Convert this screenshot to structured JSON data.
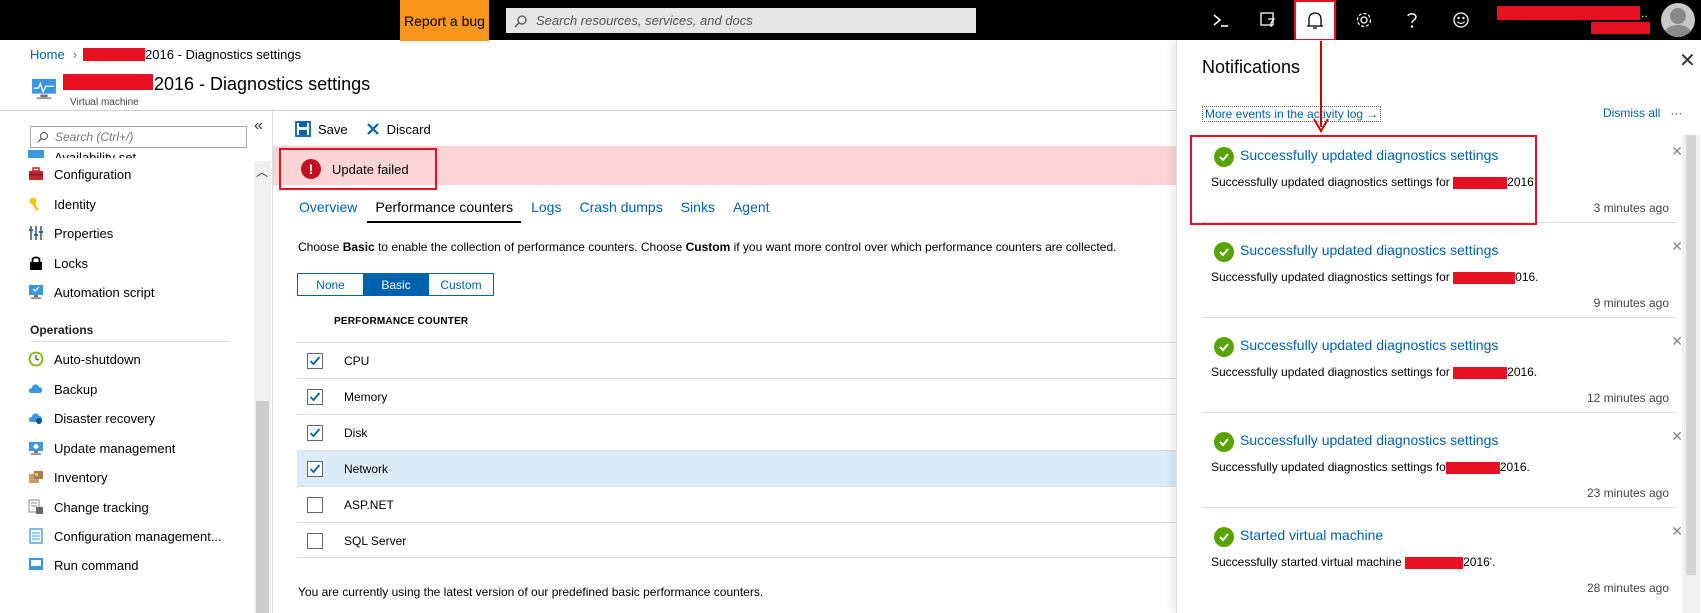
{
  "topbar": {
    "report_bug": "Report a bug",
    "search_placeholder": "Search resources, services, and docs",
    "more_dots": ".."
  },
  "breadcrumb": {
    "home": "Home",
    "current": "2016 - Diagnostics settings"
  },
  "header": {
    "title": "2016 - Diagnostics settings",
    "subtitle": "Virtual machine"
  },
  "sidebar": {
    "search_placeholder": "Search (Ctrl+/)",
    "collapse": "«",
    "partial_top": "Availability set",
    "items": [
      {
        "label": "Configuration",
        "icon": "toolbox-icon"
      },
      {
        "label": "Identity",
        "icon": "key-icon"
      },
      {
        "label": "Properties",
        "icon": "properties-icon"
      },
      {
        "label": "Locks",
        "icon": "lock-icon"
      },
      {
        "label": "Automation script",
        "icon": "script-icon"
      }
    ],
    "operations_heading": "Operations",
    "operations_items": [
      {
        "label": "Auto-shutdown",
        "icon": "clock-icon"
      },
      {
        "label": "Backup",
        "icon": "cloud-backup-icon"
      },
      {
        "label": "Disaster recovery",
        "icon": "cloud-recovery-icon"
      },
      {
        "label": "Update management",
        "icon": "monitor-icon"
      },
      {
        "label": "Inventory",
        "icon": "box-icon"
      },
      {
        "label": "Change tracking",
        "icon": "change-tracking-icon"
      },
      {
        "label": "Configuration management...",
        "icon": "list-icon"
      },
      {
        "label": "Run command",
        "icon": "terminal-icon"
      }
    ]
  },
  "toolbar": {
    "save": "Save",
    "discard": "Discard"
  },
  "error": {
    "message": "Update failed"
  },
  "tabs": [
    "Overview",
    "Performance counters",
    "Logs",
    "Crash dumps",
    "Sinks",
    "Agent"
  ],
  "description": {
    "part1": "Choose ",
    "basic": "Basic",
    "part2": " to enable the collection of performance counters. Choose ",
    "custom": "Custom",
    "part3": " if you want more control over which performance counters are collected."
  },
  "segmented": {
    "none": "None",
    "basic": "Basic",
    "custom": "Custom",
    "selected": "Basic"
  },
  "counters": {
    "header": "PERFORMANCE COUNTER",
    "rows": [
      {
        "label": "CPU",
        "checked": true
      },
      {
        "label": "Memory",
        "checked": true
      },
      {
        "label": "Disk",
        "checked": true
      },
      {
        "label": "Network",
        "checked": true
      },
      {
        "label": "ASP.NET",
        "checked": false
      },
      {
        "label": "SQL Server",
        "checked": false
      }
    ]
  },
  "footnote": "You are currently using the latest version of our predefined basic performance counters.",
  "notifications": {
    "title": "Notifications",
    "more_events": "More events in the activity log →",
    "dismiss_all": "Dismiss all",
    "more": "···",
    "items": [
      {
        "title": "Successfully updated diagnostics settings",
        "body_pre": "Successfully updated diagnostics settings for ",
        "body_post": "2016.",
        "time": "3 minutes ago"
      },
      {
        "title": "Successfully updated diagnostics settings",
        "body_pre": "Successfully updated diagnostics settings for ",
        "body_post": "016.",
        "time": "9 minutes ago"
      },
      {
        "title": "Successfully updated diagnostics settings",
        "body_pre": "Successfully updated diagnostics settings for ",
        "body_post": "2016.",
        "time": "12 minutes ago"
      },
      {
        "title": "Successfully updated diagnostics settings",
        "body_pre": "Successfully updated diagnostics settings fo",
        "body_post": "2016.",
        "time": "23 minutes ago"
      },
      {
        "title": "Started virtual machine",
        "body_pre": "Successfully started virtual machine ",
        "body_post": "2016'.",
        "time": "28 minutes ago"
      }
    ]
  },
  "colors": {
    "accent": "#0062ad",
    "bug_button": "#f7951d",
    "error_bg": "#fbd5d5",
    "success": "#57a300",
    "highlight_red": "#e81123"
  }
}
